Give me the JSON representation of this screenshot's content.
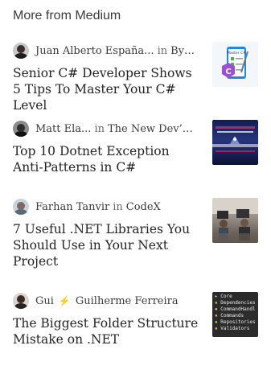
{
  "section_title": "More from Medium",
  "articles": [
    {
      "author": "Juan Alberto España...",
      "in_label": "in",
      "publication": "Byte...",
      "title": "Senior C# Developer Shows 5 Tips To Master Your C# Level",
      "thumb_text": "Master C#"
    },
    {
      "author": "Matt Ela...",
      "in_label": "in",
      "publication": "The New Dev’s Gu...",
      "title": "Top 10 Dotnet Exception Anti-Patterns in C#"
    },
    {
      "author": "Farhan Tanvir",
      "in_label": "in",
      "publication": "CodeX",
      "title": "7 Useful .NET Libraries You Should Use in Your Next Project"
    },
    {
      "author": "Gui",
      "boost_icon": "lightning-icon",
      "publication": "Guilherme Ferreira",
      "title": "The Biggest Folder Structure Mistake on .NET",
      "thumb_tree": [
        "Core",
        "Dependencies",
        "CommandHandl",
        "Commands",
        "Repositories",
        "Validators"
      ]
    }
  ]
}
